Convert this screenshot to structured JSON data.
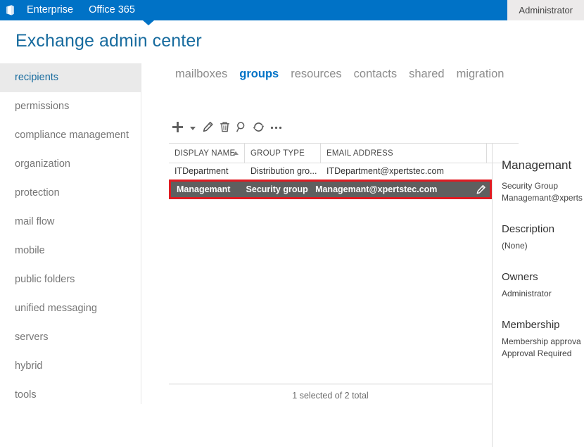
{
  "suite_bar": {
    "logo_icon": "office-logo-icon",
    "links": [
      {
        "label": "Enterprise"
      },
      {
        "label": "Office 365"
      }
    ],
    "user": "Administrator"
  },
  "page": {
    "title": "Exchange admin center"
  },
  "sidebar": {
    "items": [
      {
        "label": "recipients",
        "selected": true
      },
      {
        "label": "permissions",
        "selected": false
      },
      {
        "label": "compliance management",
        "selected": false
      },
      {
        "label": "organization",
        "selected": false
      },
      {
        "label": "protection",
        "selected": false
      },
      {
        "label": "mail flow",
        "selected": false
      },
      {
        "label": "mobile",
        "selected": false
      },
      {
        "label": "public folders",
        "selected": false
      },
      {
        "label": "unified messaging",
        "selected": false
      },
      {
        "label": "servers",
        "selected": false
      },
      {
        "label": "hybrid",
        "selected": false
      },
      {
        "label": "tools",
        "selected": false
      }
    ]
  },
  "tabs": [
    {
      "label": "mailboxes",
      "active": false
    },
    {
      "label": "groups",
      "active": true
    },
    {
      "label": "resources",
      "active": false
    },
    {
      "label": "contacts",
      "active": false
    },
    {
      "label": "shared",
      "active": false
    },
    {
      "label": "migration",
      "active": false
    }
  ],
  "toolbar": {
    "new_icon": "plus-icon",
    "new_dropdown_icon": "chevron-down-icon",
    "edit_icon": "pencil-icon",
    "delete_icon": "trash-icon",
    "search_icon": "magnifier-icon",
    "refresh_icon": "refresh-icon",
    "more_icon": "ellipsis-icon"
  },
  "grid": {
    "columns": [
      {
        "label": "DISPLAY NAME",
        "sorted": "asc"
      },
      {
        "label": "GROUP TYPE",
        "sorted": ""
      },
      {
        "label": "EMAIL ADDRESS",
        "sorted": ""
      },
      {
        "label": "",
        "sorted": ""
      }
    ],
    "rows": [
      {
        "display_name": "ITDepartment",
        "group_type": "Distribution gro...",
        "email": "ITDepartment@xpertstec.com",
        "selected": false
      },
      {
        "display_name": "Managemant",
        "group_type": "Security group",
        "email": "Managemant@xpertstec.com",
        "selected": true,
        "row_edit_icon": "pencil-icon"
      }
    ]
  },
  "detail_pane": {
    "title": "Managemant",
    "type": "Security Group",
    "email": "Managemant@xperts",
    "description_heading": "Description",
    "description_value": "(None)",
    "owners_heading": "Owners",
    "owners_value": "Administrator",
    "membership_heading": "Membership",
    "membership_line1": "Membership approva",
    "membership_line2": "Approval Required"
  },
  "footer": {
    "status": "1 selected of 2 total"
  },
  "colors": {
    "suite_bar": "#0072c6",
    "accent_blue": "#0072c6",
    "title_blue": "#176b9e",
    "selected_row_bg": "#5f5f5f",
    "annotation_red": "#e01b22",
    "sidebar_selected_bg": "#eaeaea"
  }
}
